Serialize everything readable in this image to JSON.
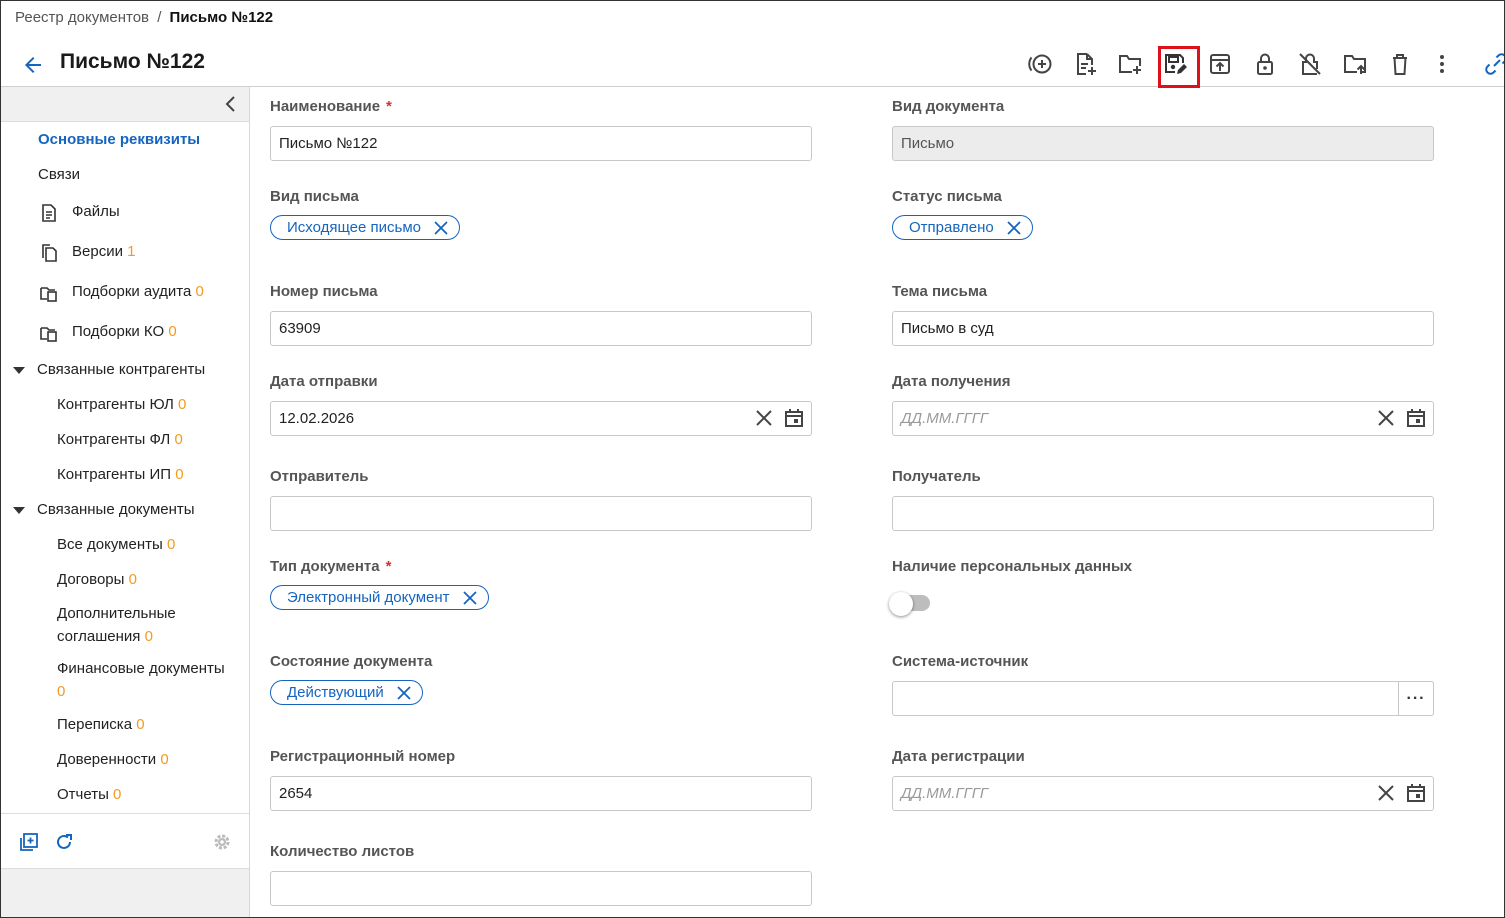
{
  "breadcrumb": {
    "root": "Реестр документов",
    "separator": "/",
    "current": "Письмо №122"
  },
  "header": {
    "title": "Письмо №122"
  },
  "toolbar": {
    "buttons": [
      "add-circle-icon",
      "file-add-icon",
      "folder-add-icon",
      "save-edit-icon",
      "upload-icon",
      "lock-icon",
      "unlock-off-icon",
      "folder-upload-icon",
      "delete-icon",
      "more-vert-icon",
      "link-icon"
    ],
    "selected": "save-edit-icon",
    "highlight_color": "#e0101a"
  },
  "sidebar": {
    "main_label": "Основные реквизиты",
    "links_label": "Связи",
    "files": {
      "label": "Файлы"
    },
    "versions": {
      "label": "Версии",
      "count": "1"
    },
    "audit": {
      "label": "Подборки аудита",
      "count": "0"
    },
    "ko": {
      "label": "Подборки КО",
      "count": "0"
    },
    "counterparties": {
      "label": "Связанные контрагенты",
      "ul": {
        "label": "Контрагенты ЮЛ",
        "count": "0"
      },
      "fl": {
        "label": "Контрагенты ФЛ",
        "count": "0"
      },
      "ip": {
        "label": "Контрагенты ИП",
        "count": "0"
      }
    },
    "documents": {
      "label": "Связанные документы",
      "all": {
        "label": "Все документы",
        "count": "0"
      },
      "contracts": {
        "label": "Договоры",
        "count": "0"
      },
      "agreements": {
        "label": "Дополнительные соглашения",
        "count": "0"
      },
      "finance": {
        "label": "Финансовые документы",
        "count": "0"
      },
      "correspondence": {
        "label": "Переписка",
        "count": "0"
      },
      "poa": {
        "label": "Доверенности",
        "count": "0"
      },
      "reports": {
        "label": "Отчеты",
        "count": "0"
      }
    }
  },
  "form": {
    "name": {
      "label": "Наименование",
      "required": "*",
      "value": "Письмо №122"
    },
    "doc_kind": {
      "label": "Вид документа",
      "value": "Письмо"
    },
    "letter_kind": {
      "label": "Вид письма",
      "chip": "Исходящее письмо"
    },
    "letter_status": {
      "label": "Статус письма",
      "chip": "Отправлено"
    },
    "letter_number": {
      "label": "Номер письма",
      "value": "63909"
    },
    "letter_subject": {
      "label": "Тема письма",
      "value": "Письмо в суд"
    },
    "sent_date": {
      "label": "Дата отправки",
      "value": "12.02.2026"
    },
    "received_date": {
      "label": "Дата получения",
      "placeholder": "ДД.ММ.ГГГГ"
    },
    "sender": {
      "label": "Отправитель",
      "value": ""
    },
    "recipient": {
      "label": "Получатель",
      "value": ""
    },
    "doc_type": {
      "label": "Тип документа",
      "required": "*",
      "chip": "Электронный документ"
    },
    "personal_data": {
      "label": "Наличие персональных данных",
      "enabled": false
    },
    "doc_state": {
      "label": "Состояние документа",
      "chip": "Действующий"
    },
    "source_system": {
      "label": "Система-источник",
      "value": "",
      "button": "···"
    },
    "reg_number": {
      "label": "Регистрационный номер",
      "value": "2654"
    },
    "reg_date": {
      "label": "Дата регистрации",
      "placeholder": "ДД.ММ.ГГГГ"
    },
    "sheet_count": {
      "label": "Количество листов",
      "value": ""
    }
  },
  "colors": {
    "accent": "#1565c0",
    "count": "#f29b1f",
    "required": "#d32f2f"
  }
}
